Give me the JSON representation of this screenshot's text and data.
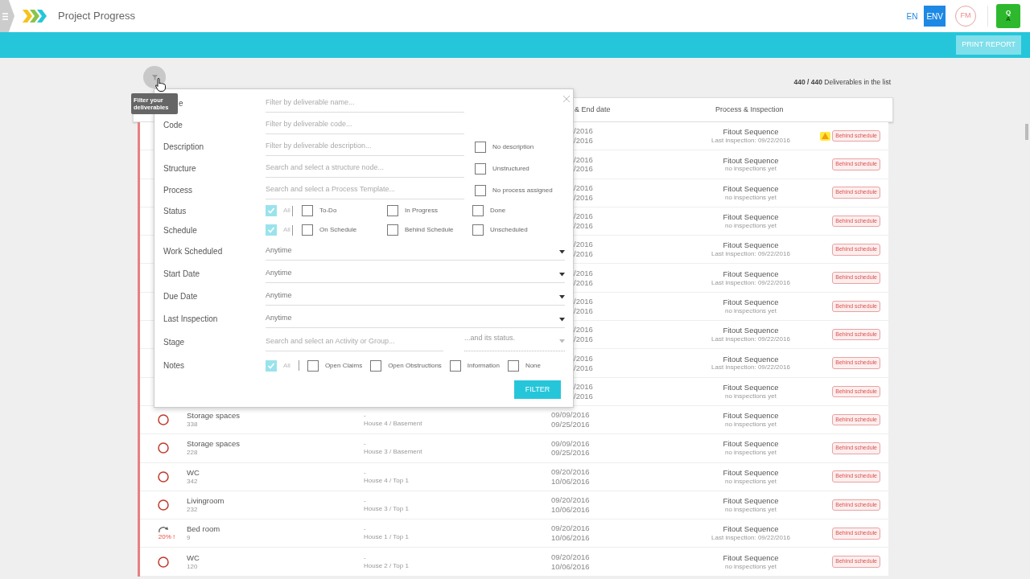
{
  "header": {
    "title": "Project Progress",
    "languages": [
      {
        "label": "EN",
        "selected": false
      },
      {
        "label": "ENV",
        "selected": true
      }
    ],
    "user_initials": "FM",
    "chat_letters": [
      "Q",
      "A"
    ]
  },
  "toolbar": {
    "button": "PRINT REPORT"
  },
  "summary": {
    "text": "**440 / 440** Deliverables in the list"
  },
  "filter_button": {
    "tooltip": "Filter your deliverables"
  },
  "filter_panel": {
    "fields": [
      {
        "label": "e",
        "kind": "text",
        "placeholder": "Filter by deliverable name..."
      },
      {
        "label": "Code",
        "kind": "text",
        "placeholder": "Filter by deliverable code..."
      },
      {
        "label": "Description",
        "kind": "text",
        "placeholder": "Filter by deliverable description...",
        "option": {
          "label": "No description",
          "checked": false
        }
      },
      {
        "label": "Structure",
        "kind": "text",
        "placeholder": "Search and select a structure node...",
        "option": {
          "label": "Unstructured",
          "checked": false
        }
      },
      {
        "label": "Process",
        "kind": "text",
        "placeholder": "Search and select a Process Template...",
        "option": {
          "label": "No process assigned",
          "checked": false
        }
      },
      {
        "label": "Status",
        "kind": "checks_grid",
        "options": [
          {
            "label": "All",
            "checked": true
          },
          {
            "label": "To-Do",
            "checked": false
          },
          {
            "label": "In Progress",
            "checked": false
          },
          {
            "label": "Done",
            "checked": false
          }
        ]
      },
      {
        "label": "Schedule",
        "kind": "checks_grid",
        "options": [
          {
            "label": "All",
            "checked": true
          },
          {
            "label": "On Schedule",
            "checked": false
          },
          {
            "label": "Behind Schedule",
            "checked": false
          },
          {
            "label": "Unscheduled",
            "checked": false
          }
        ]
      },
      {
        "label": "Work Scheduled",
        "kind": "select",
        "value": "Anytime"
      },
      {
        "label": "Start Date",
        "kind": "select",
        "value": "Anytime"
      },
      {
        "label": "Due Date",
        "kind": "select",
        "value": "Anytime"
      },
      {
        "label": "Last Inspection",
        "kind": "select",
        "value": "Anytime"
      },
      {
        "label": "Stage",
        "kind": "stage",
        "placeholder": "Search and select an Activity or Group...",
        "status_placeholder": "...and its status."
      },
      {
        "label": "Notes",
        "kind": "checks_inline",
        "options": [
          {
            "label": "All",
            "checked": true
          },
          {
            "label": "Open Claims",
            "checked": false
          },
          {
            "label": "Open Obstructions",
            "checked": false
          },
          {
            "label": "Information",
            "checked": false
          },
          {
            "label": "None",
            "checked": false
          }
        ]
      }
    ],
    "submit": "FILTER"
  },
  "table": {
    "columns": [
      "& End date",
      "Process & Inspection"
    ],
    "rows": [
      {
        "dates": [
          "/2016",
          "/2016"
        ],
        "process": "Fitout Sequence",
        "inspection": "Last inspection: 09/22/2016",
        "badge": "Behind schedule",
        "warning": true
      },
      {
        "dates": [
          "/2016",
          "/2016"
        ],
        "process": "Fitout Sequence",
        "inspection": "no inspections yet",
        "badge": "Behind schedule",
        "warning": false
      },
      {
        "dates": [
          "/2016",
          "/2016"
        ],
        "process": "Fitout Sequence",
        "inspection": "no inspections yet",
        "badge": "Behind schedule",
        "warning": false
      },
      {
        "dates": [
          "/2016",
          "/2016"
        ],
        "process": "Fitout Sequence",
        "inspection": "no inspections yet",
        "badge": "Behind schedule",
        "warning": false
      },
      {
        "dates": [
          "/2016",
          "/2016"
        ],
        "process": "Fitout Sequence",
        "inspection": "Last inspection: 09/22/2016",
        "badge": "Behind schedule",
        "warning": false
      },
      {
        "dates": [
          "/2016",
          "/2016"
        ],
        "process": "Fitout Sequence",
        "inspection": "Last inspection: 09/22/2016",
        "badge": "Behind schedule",
        "warning": false
      },
      {
        "dates": [
          "/2016",
          "/2016"
        ],
        "process": "Fitout Sequence",
        "inspection": "no inspections yet",
        "badge": "Behind schedule",
        "warning": false
      },
      {
        "dates": [
          "/2016",
          "/2016"
        ],
        "process": "Fitout Sequence",
        "inspection": "Last inspection: 09/22/2016",
        "badge": "Behind schedule",
        "warning": false
      },
      {
        "dates": [
          "/2016",
          "/2016"
        ],
        "process": "Fitout Sequence",
        "inspection": "Last inspection: 09/22/2016",
        "badge": "Behind schedule",
        "warning": false
      },
      {
        "dates": [
          "/2016",
          "/2016"
        ],
        "process": "Fitout Sequence",
        "inspection": "no inspections yet",
        "badge": "Behind schedule",
        "warning": false
      },
      {
        "kind": "not_started",
        "name": "Storage spaces",
        "code": "338",
        "description": "-",
        "location": "House 4 / Basement",
        "dates": [
          "09/09/2016",
          "09/25/2016"
        ],
        "process": "Fitout Sequence",
        "inspection": "no inspections yet",
        "badge": "Behind schedule",
        "warning": false
      },
      {
        "kind": "not_started",
        "name": "Storage spaces",
        "code": "228",
        "description": "-",
        "location": "House 3 / Basement",
        "dates": [
          "09/09/2016",
          "09/25/2016"
        ],
        "process": "Fitout Sequence",
        "inspection": "no inspections yet",
        "badge": "Behind schedule",
        "warning": false
      },
      {
        "kind": "not_started",
        "name": "WC",
        "code": "342",
        "description": "-",
        "location": "House 4 / Top 1",
        "dates": [
          "09/20/2016",
          "10/06/2016"
        ],
        "process": "Fitout Sequence",
        "inspection": "no inspections yet",
        "badge": "Behind schedule",
        "warning": false
      },
      {
        "kind": "not_started",
        "name": "Livingroom",
        "code": "232",
        "description": "-",
        "location": "House 3 / Top 1",
        "dates": [
          "09/20/2016",
          "10/06/2016"
        ],
        "process": "Fitout Sequence",
        "inspection": "no inspections yet",
        "badge": "Behind schedule",
        "warning": false
      },
      {
        "kind": "in_progress",
        "progress": "20% !",
        "name": "Bed room",
        "code": "9",
        "description": "-",
        "location": "House 1 / Top 1",
        "dates": [
          "09/20/2016",
          "10/06/2016"
        ],
        "process": "Fitout Sequence",
        "inspection": "Last inspection: 09/22/2016",
        "badge": "Behind schedule",
        "warning": false
      },
      {
        "kind": "not_started",
        "name": "WC",
        "code": "120",
        "description": "-",
        "location": "House 2 / Top 1",
        "dates": [
          "09/20/2016",
          "10/06/2016"
        ],
        "process": "Fitout Sequence",
        "inspection": "no inspections yet",
        "badge": "Behind schedule",
        "warning": false
      }
    ]
  }
}
